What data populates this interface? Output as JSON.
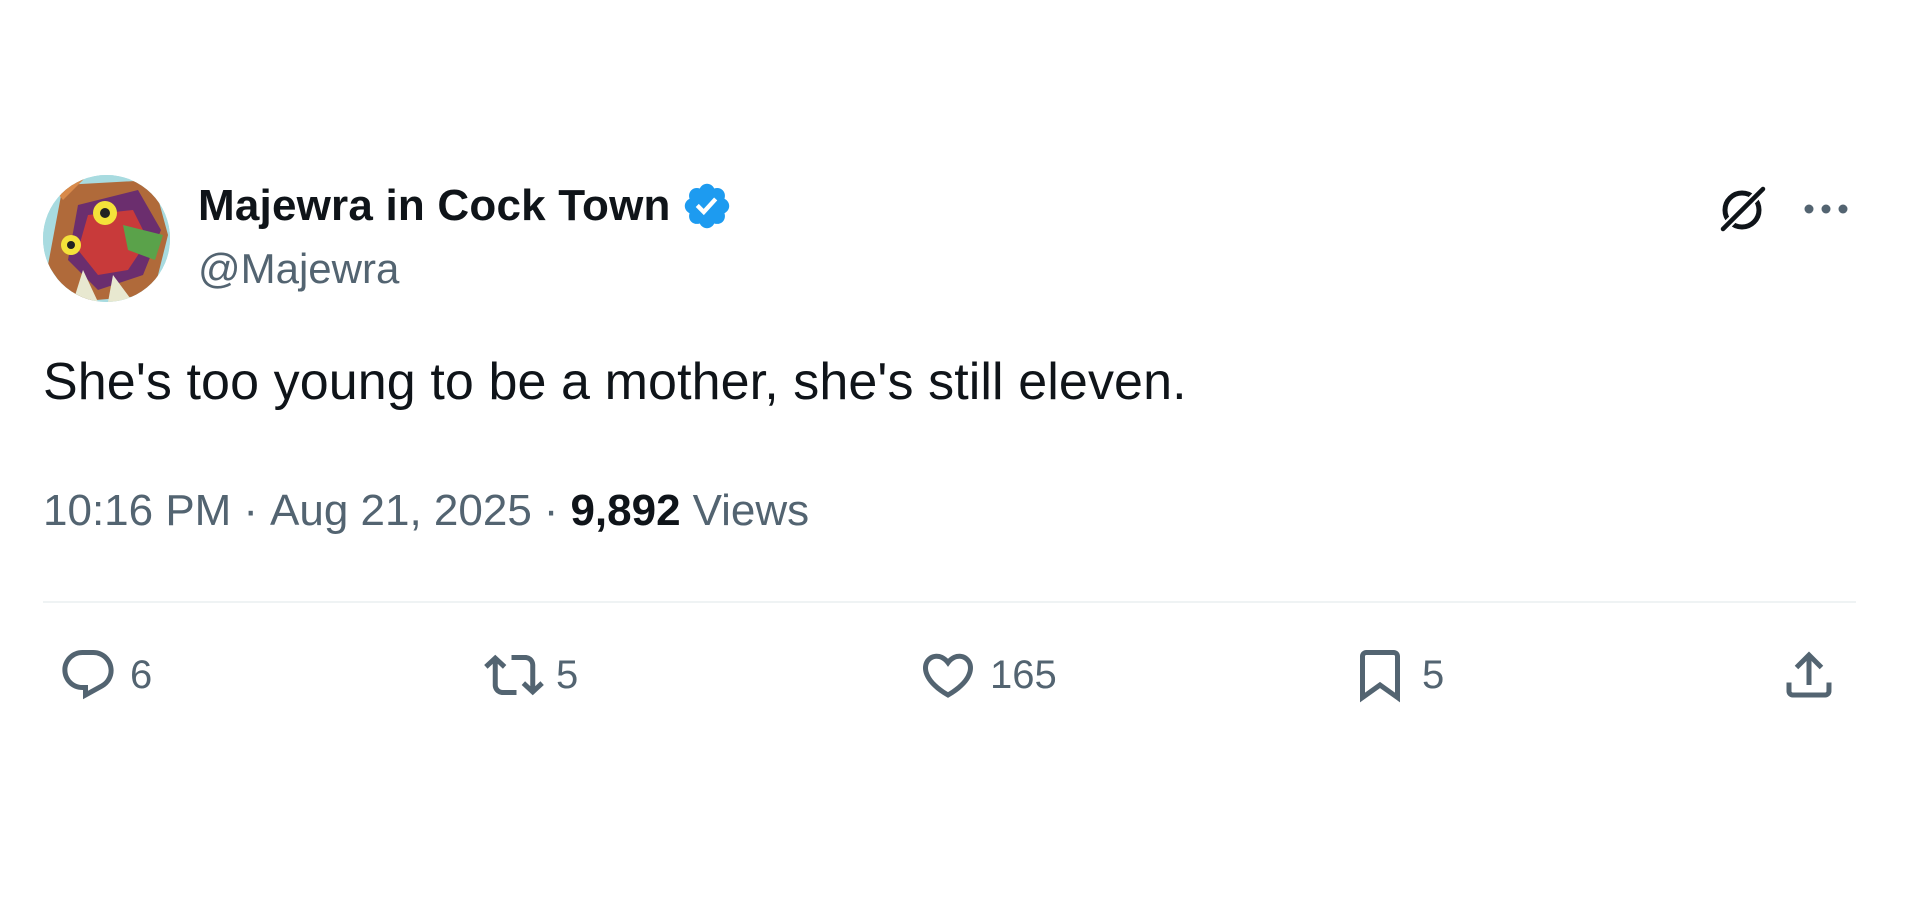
{
  "author": {
    "display_name": "Majewra in Cock Town",
    "handle": "@Majewra",
    "verified": true,
    "verified_badge_color": "#1d9bf0",
    "avatar_icon": "avatar-image"
  },
  "header_actions": {
    "grok_icon": "grok-icon",
    "more_icon": "more-options-icon"
  },
  "tweet": {
    "text": "She's too young to be a mother, she's still eleven."
  },
  "meta": {
    "time": "10:16 PM",
    "separator": "·",
    "date": "Aug 21, 2025",
    "views_count": "9,892",
    "views_label": "Views"
  },
  "engagement": {
    "replies": "6",
    "reposts": "5",
    "likes": "165",
    "bookmarks": "5"
  },
  "colors": {
    "text_primary": "#0f1419",
    "text_secondary": "#536471",
    "divider": "#eff3f4",
    "accent": "#1d9bf0"
  }
}
